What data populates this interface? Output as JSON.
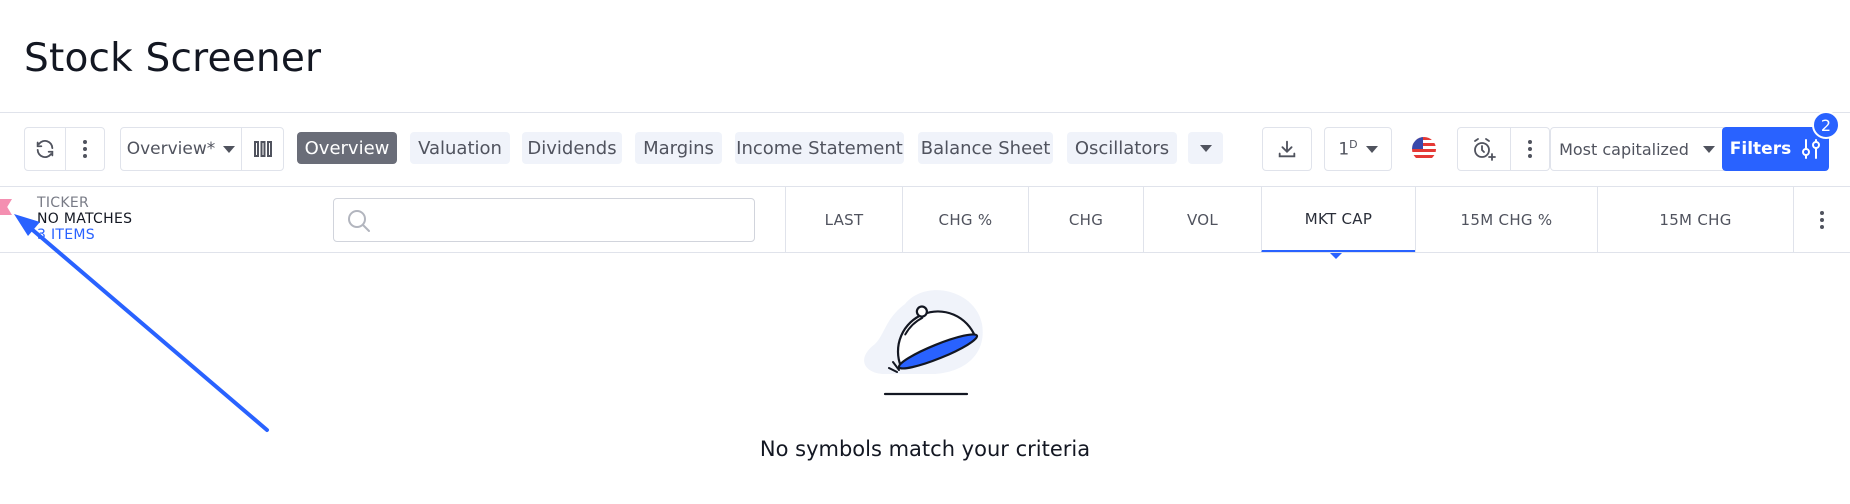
{
  "page": {
    "title": "Stock Screener"
  },
  "toolbar": {
    "screen_name": "Overview*",
    "tabs": [
      "Overview",
      "Valuation",
      "Dividends",
      "Margins",
      "Income Statement",
      "Balance Sheet",
      "Oscillators"
    ],
    "active_tab": "Overview",
    "interval": "1",
    "interval_sup": "D",
    "sort_label": "Most capitalized",
    "filters_label": "Filters",
    "filters_count": "2"
  },
  "table": {
    "ticker_header": "TICKER",
    "match_status": "NO MATCHES",
    "items_count": "3 ITEMS",
    "search_placeholder": "",
    "columns": [
      "LAST",
      "CHG %",
      "CHG",
      "VOL",
      "MKT CAP",
      "15M CHG %",
      "15M CHG"
    ],
    "active_column": "MKT CAP"
  },
  "empty_state": {
    "message": "No symbols match your criteria"
  },
  "colors": {
    "accent": "#2962ff",
    "active_tab_bg": "#6a6d78",
    "tab_bg": "#f0f3fa",
    "flag": "#f48fb1"
  },
  "icons": [
    "refresh-icon",
    "more-vertical-icon",
    "columns-icon",
    "download-icon",
    "us-flag-icon",
    "alarm-add-icon",
    "sliders-icon",
    "search-icon",
    "cloche-icon"
  ]
}
